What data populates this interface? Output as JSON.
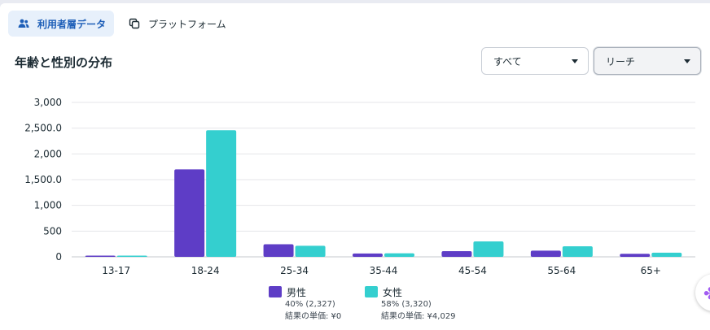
{
  "tabs": [
    {
      "label": "利用者層データ",
      "icon": "people-icon",
      "active": true
    },
    {
      "label": "プラットフォーム",
      "icon": "copy-icon",
      "active": false
    }
  ],
  "section_title": "年齢と性別の分布",
  "filters": {
    "scope": {
      "selected": "すべて"
    },
    "metric": {
      "selected": "リーチ"
    }
  },
  "colors": {
    "male": "#5e3dc6",
    "female": "#34cfcf",
    "grid": "#e4e6ea",
    "axis_text": "#1c2b33"
  },
  "legend": [
    {
      "label": "男性",
      "detail": "40% (2,327)",
      "cost": "結果の単価: ¥0"
    },
    {
      "label": "女性",
      "detail": "58% (3,320)",
      "cost": "結果の単価: ¥4,029"
    }
  ],
  "chart_data": {
    "type": "bar",
    "categories": [
      "13-17",
      "18-24",
      "25-34",
      "35-44",
      "45-54",
      "55-64",
      "65+"
    ],
    "series": [
      {
        "name": "男性",
        "values": [
          5,
          1700,
          245,
          65,
          110,
          120,
          60
        ]
      },
      {
        "name": "女性",
        "values": [
          8,
          2460,
          215,
          70,
          300,
          205,
          80
        ]
      }
    ],
    "yticks": [
      {
        "value": 0,
        "label": "0"
      },
      {
        "value": 500,
        "label": "500"
      },
      {
        "value": 1000,
        "label": "1,000"
      },
      {
        "value": 1500,
        "label": "1,500.0"
      },
      {
        "value": 2000,
        "label": "2,000"
      },
      {
        "value": 2500,
        "label": "2,500.0"
      },
      {
        "value": 3000,
        "label": "3,000"
      }
    ],
    "ylim": [
      0,
      3000
    ],
    "grid": true,
    "legend_position": "bottom"
  }
}
